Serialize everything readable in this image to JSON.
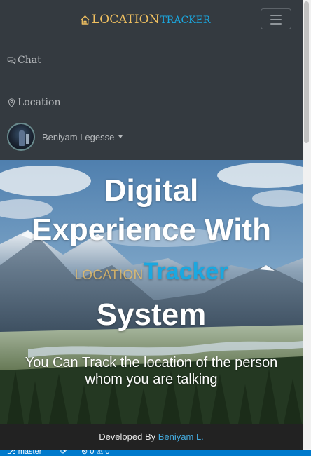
{
  "navbar": {
    "brand": {
      "main": "LOCATION",
      "sub": "TRACKER",
      "icon": "home-icon"
    },
    "toggler_icon": "hamburger-icon",
    "links": [
      {
        "label": "Chat",
        "icon": "chat-icon"
      },
      {
        "label": "Location",
        "icon": "map-pin-icon"
      }
    ],
    "user": {
      "name": "Beniyam Legesse",
      "caret_icon": "caret-down-icon"
    }
  },
  "hero": {
    "title_line1": "Digital",
    "title_line2": "Experience With",
    "title_loc": "LOCATION",
    "title_tracker": "Tracker",
    "title_line4": "System",
    "subtitle_line1": "You Can Track the location of the person",
    "subtitle_line2": "whom you are talking"
  },
  "footer": {
    "prefix": "Developed By",
    "author": "Beniyam L."
  },
  "statusbar": {
    "branch": "master",
    "errors": "0",
    "warnings": "0"
  },
  "colors": {
    "navbar_bg": "#343a40",
    "brand_gold": "#f0c060",
    "brand_blue": "#1ba8e0",
    "footer_bg": "#222222",
    "statusbar_bg": "#007acc"
  }
}
